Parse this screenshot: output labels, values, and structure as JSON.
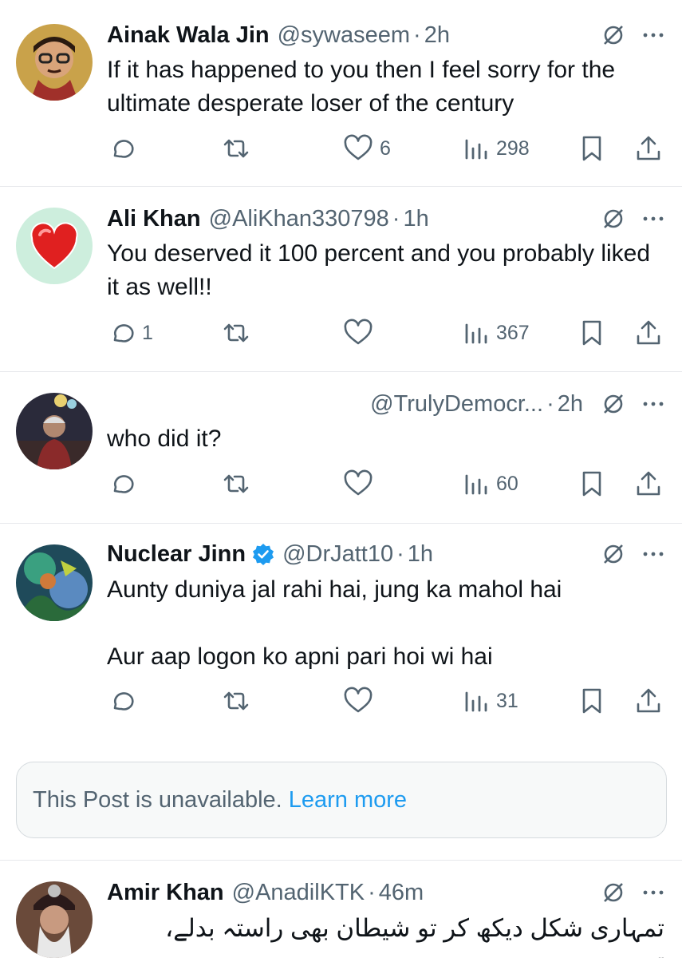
{
  "posts": [
    {
      "name": "Ainak Wala Jin",
      "handle": "@sywaseem",
      "dot": "·",
      "time": "2h",
      "text": [
        "If it has happened to you then I feel sorry for the ultimate desperate loser of the century"
      ],
      "replies": "",
      "reposts": "",
      "likes": "6",
      "views": "298"
    },
    {
      "name": "Ali Khan",
      "handle": "@AliKhan330798",
      "dot": "·",
      "time": "1h",
      "text": [
        "You deserved it 100 percent and you probably liked it as well!!"
      ],
      "replies": "1",
      "reposts": "",
      "likes": "",
      "views": "367"
    },
    {
      "name": "",
      "handle": "@TrulyDemocr...",
      "dot": "·",
      "time": "2h",
      "text": [
        "who did it?"
      ],
      "replies": "",
      "reposts": "",
      "likes": "",
      "views": "60"
    },
    {
      "name": "Nuclear Jinn",
      "handle": "@DrJatt10",
      "dot": "·",
      "time": "1h",
      "text": [
        "Aunty duniya jal rahi hai, jung ka mahol hai",
        "Aur aap logon ko apni pari hoi wi hai"
      ],
      "replies": "",
      "reposts": "",
      "likes": "",
      "views": "31"
    },
    {
      "name": "Amir Khan",
      "handle": "@AnadilKTK",
      "dot": "·",
      "time": "46m",
      "text": [
        "تمہاری شکل دیکھ کر تو شیطان بھی راستہ بدلے، تمہیں"
      ],
      "replies": "",
      "reposts": "",
      "likes": "",
      "views": ""
    }
  ],
  "unavailable": {
    "message": "This Post is unavailable.",
    "link": "Learn more"
  },
  "icons": {
    "reply": "reply-icon",
    "repost": "repost-icon",
    "like": "heart-icon",
    "views": "views-icon",
    "bookmark": "bookmark-icon",
    "share": "share-icon",
    "grok": "grok-icon",
    "more": "more-icon",
    "verified": "verified-badge-icon"
  },
  "colors": {
    "text": "#0f1419",
    "secondary": "#536471",
    "link": "#1d9bf0",
    "verified": "#1d9bf0",
    "divider": "#e7e9ec"
  }
}
